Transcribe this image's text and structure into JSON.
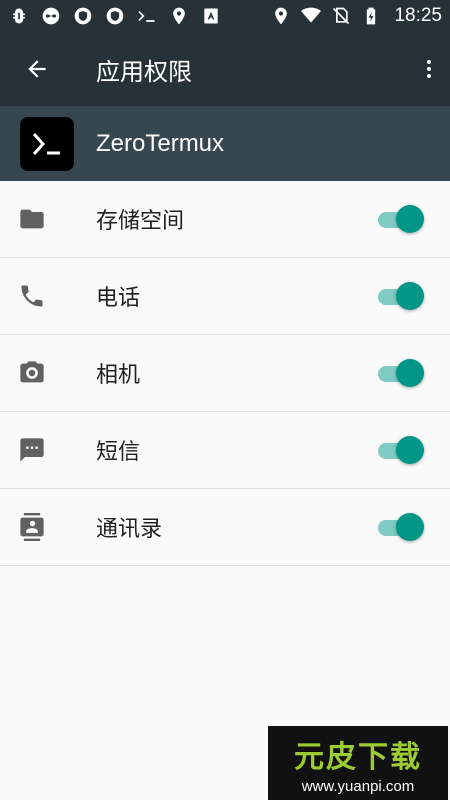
{
  "status_bar": {
    "time": "18:25",
    "left_icons": [
      "bug-icon",
      "infinity-icon",
      "shield-icon",
      "shield-icon-2",
      "terminal-icon",
      "location-icon",
      "keyboard-icon"
    ],
    "right_icons": [
      "location-icon",
      "wifi-icon",
      "no-sim-icon",
      "battery-charging-icon"
    ]
  },
  "app_bar": {
    "title": "应用权限"
  },
  "app": {
    "name": "ZeroTermux"
  },
  "permissions": [
    {
      "label": "存储空间",
      "icon": "folder-icon",
      "enabled": true
    },
    {
      "label": "电话",
      "icon": "phone-icon",
      "enabled": true
    },
    {
      "label": "相机",
      "icon": "camera-icon",
      "enabled": true
    },
    {
      "label": "短信",
      "icon": "sms-icon",
      "enabled": true
    },
    {
      "label": "通讯录",
      "icon": "contacts-icon",
      "enabled": true
    }
  ],
  "colors": {
    "toolbar": "#263238",
    "app_header": "#37474f",
    "toggle_on": "#009688",
    "toggle_track": "#80cbc4"
  },
  "watermark": {
    "title": "元皮下载",
    "url": "www.yuanpi.com"
  }
}
